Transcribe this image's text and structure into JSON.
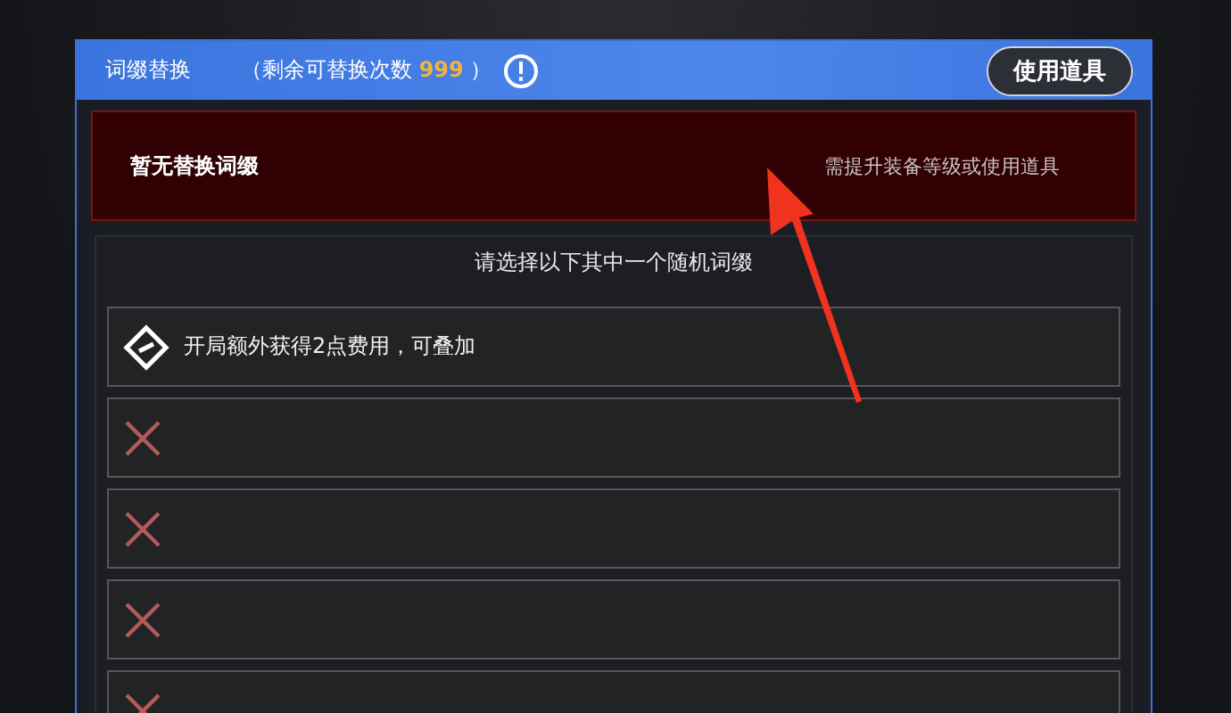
{
  "header": {
    "title": "词缀替换",
    "remaining_label": "（剩余可替换次数",
    "remaining_count": "999",
    "remaining_close": "）",
    "use_item_button": "使用道具"
  },
  "banner": {
    "title": "暂无替换词缀",
    "hint": "需提升装备等级或使用道具"
  },
  "choice": {
    "prompt": "请选择以下其中一个随机词缀",
    "options": [
      {
        "kind": "affix",
        "text": "开局额外获得2点费用，可叠加"
      },
      {
        "kind": "empty"
      },
      {
        "kind": "empty"
      },
      {
        "kind": "empty"
      },
      {
        "kind": "empty"
      }
    ]
  }
}
